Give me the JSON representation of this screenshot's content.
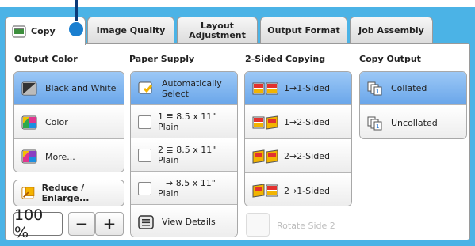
{
  "tabs": [
    {
      "label": "Copy",
      "active": true
    },
    {
      "label": "Image Quality"
    },
    {
      "label": "Layout Adjustment"
    },
    {
      "label": "Output Format"
    },
    {
      "label": "Job Assembly"
    }
  ],
  "output_color": {
    "header": "Output Color",
    "options": [
      {
        "label": "Black and White",
        "selected": true,
        "icon": "black-white-icon"
      },
      {
        "label": "Color",
        "icon": "color-icon"
      },
      {
        "label": "More...",
        "icon": "more-colors-icon"
      }
    ],
    "reduce_enlarge_label": "Reduce / Enlarge...",
    "zoom_value": "100 %",
    "minus_label": "−",
    "plus_label": "+"
  },
  "paper_supply": {
    "header": "Paper Supply",
    "options": [
      {
        "line1": "Automatically",
        "line2": "Select",
        "selected": true,
        "icon": "auto-select-icon"
      },
      {
        "line1": "1  ≣  8.5 x 11\"",
        "line2": "Plain"
      },
      {
        "line1": "2  ≣  8.5 x 11\"",
        "line2": "Plain"
      },
      {
        "line1": "→  8.5 x 11\"",
        "line2": "Plain"
      }
    ],
    "view_details_label": "View Details"
  },
  "two_sided": {
    "header": "2-Sided Copying",
    "options": [
      {
        "label": "1→1-Sided",
        "selected": true,
        "icon": "one-to-one-sided-icon"
      },
      {
        "label": "1→2-Sided",
        "icon": "one-to-two-sided-icon"
      },
      {
        "label": "2→2-Sided",
        "icon": "two-to-two-sided-icon"
      },
      {
        "label": "2→1-Sided",
        "icon": "two-to-one-sided-icon"
      }
    ],
    "rotate_label": "Rotate Side 2"
  },
  "copy_output": {
    "header": "Copy Output",
    "options": [
      {
        "label": "Collated",
        "selected": true,
        "icon": "collated-icon"
      },
      {
        "label": "Uncollated",
        "icon": "uncollated-icon"
      }
    ]
  },
  "colors": {
    "frame": "#4bb3e6",
    "selected": "#7fb6ef",
    "pointer": "#0a3a78"
  }
}
